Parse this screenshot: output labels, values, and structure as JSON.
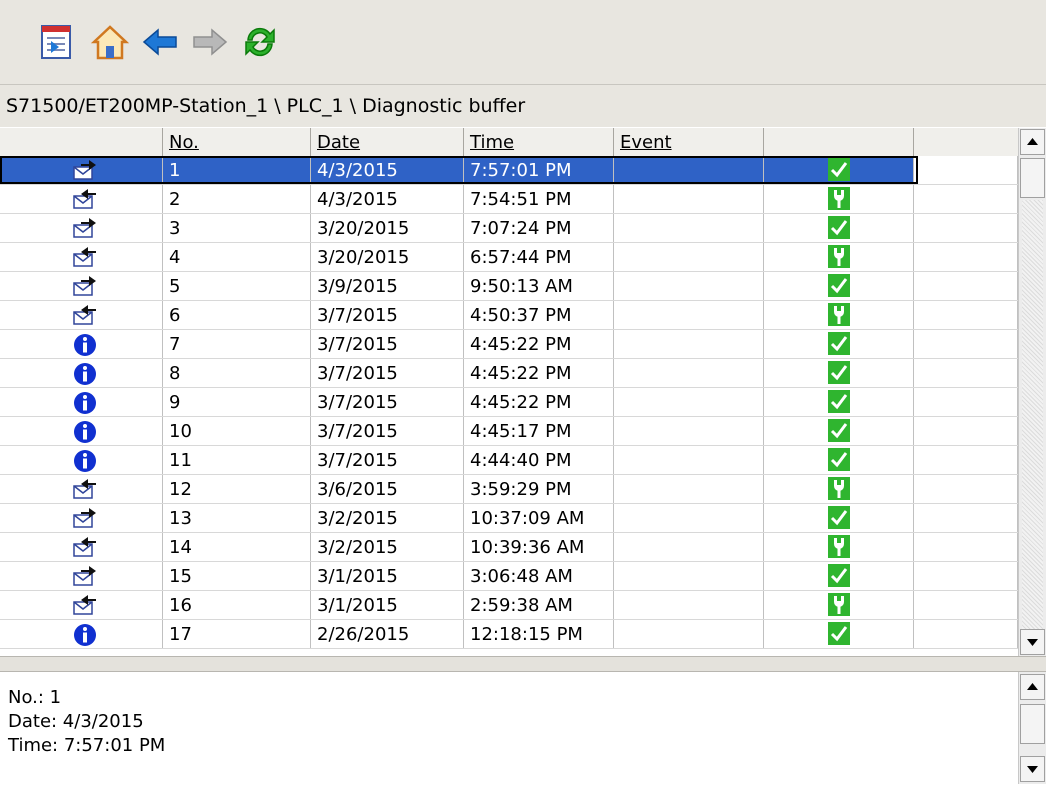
{
  "toolbar": {
    "buttons": [
      {
        "name": "export-icon",
        "label": "Export"
      },
      {
        "name": "home-icon",
        "label": "Home"
      },
      {
        "name": "back-arrow-icon",
        "label": "Back"
      },
      {
        "name": "forward-arrow-icon",
        "label": "Forward"
      },
      {
        "name": "refresh-icon",
        "label": "Refresh"
      }
    ]
  },
  "breadcrumb": "S71500/ET200MP-Station_1 \\  PLC_1 \\ Diagnostic buffer",
  "table": {
    "columns": [
      "",
      "No.",
      "Date",
      "Time",
      "Event",
      ""
    ],
    "rows": [
      {
        "icon": "incoming",
        "no": "1",
        "date": "4/3/2015",
        "time": "7:57:01 PM",
        "status": "check"
      },
      {
        "icon": "outgoing",
        "no": "2",
        "date": "4/3/2015",
        "time": "7:54:51 PM",
        "status": "wrench"
      },
      {
        "icon": "incoming",
        "no": "3",
        "date": "3/20/2015",
        "time": "7:07:24 PM",
        "status": "check"
      },
      {
        "icon": "outgoing",
        "no": "4",
        "date": "3/20/2015",
        "time": "6:57:44 PM",
        "status": "wrench"
      },
      {
        "icon": "incoming",
        "no": "5",
        "date": "3/9/2015",
        "time": "9:50:13 AM",
        "status": "check"
      },
      {
        "icon": "outgoing",
        "no": "6",
        "date": "3/7/2015",
        "time": "4:50:37 PM",
        "status": "wrench"
      },
      {
        "icon": "info",
        "no": "7",
        "date": "3/7/2015",
        "time": "4:45:22 PM",
        "status": "check"
      },
      {
        "icon": "info",
        "no": "8",
        "date": "3/7/2015",
        "time": "4:45:22 PM",
        "status": "check"
      },
      {
        "icon": "info",
        "no": "9",
        "date": "3/7/2015",
        "time": "4:45:22 PM",
        "status": "check"
      },
      {
        "icon": "info",
        "no": "10",
        "date": "3/7/2015",
        "time": "4:45:17 PM",
        "status": "check"
      },
      {
        "icon": "info",
        "no": "11",
        "date": "3/7/2015",
        "time": "4:44:40 PM",
        "status": "check"
      },
      {
        "icon": "outgoing",
        "no": "12",
        "date": "3/6/2015",
        "time": "3:59:29 PM",
        "status": "wrench"
      },
      {
        "icon": "incoming",
        "no": "13",
        "date": "3/2/2015",
        "time": "10:37:09 AM",
        "status": "check"
      },
      {
        "icon": "outgoing",
        "no": "14",
        "date": "3/2/2015",
        "time": "10:39:36 AM",
        "status": "wrench"
      },
      {
        "icon": "incoming",
        "no": "15",
        "date": "3/1/2015",
        "time": "3:06:48 AM",
        "status": "check"
      },
      {
        "icon": "outgoing",
        "no": "16",
        "date": "3/1/2015",
        "time": "2:59:38 AM",
        "status": "wrench"
      },
      {
        "icon": "info",
        "no": "17",
        "date": "2/26/2015",
        "time": "12:18:15 PM",
        "status": "check"
      }
    ],
    "selected_index": 0
  },
  "details": {
    "no": "No.: 1",
    "date": "Date: 4/3/2015",
    "time": "Time: 7:57:01 PM"
  },
  "colors": {
    "selection": "#2f62c6",
    "check_green": "#2fb52f",
    "info_blue": "#1030d0",
    "arrow_blue": "#1e78d6"
  }
}
